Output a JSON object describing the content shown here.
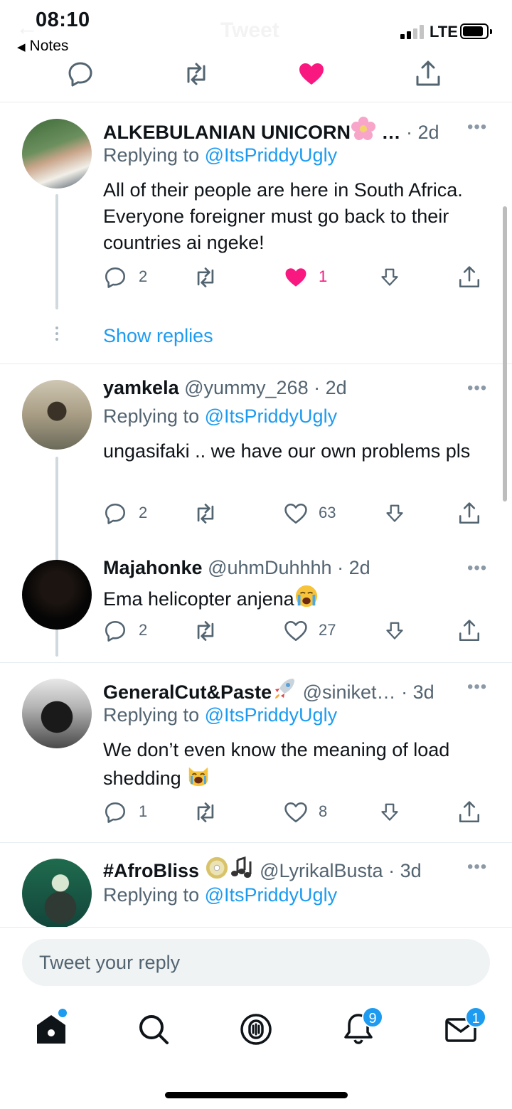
{
  "status_bar": {
    "time": "08:10",
    "back_label": "Notes",
    "network": "LTE",
    "header_title_ghost": "Tweet"
  },
  "top_actions": {
    "icons": [
      "reply-icon",
      "retweet-icon",
      "like-icon-filled",
      "share-icon"
    ],
    "liked": true
  },
  "colors": {
    "link_blue": "#1d9bf0",
    "like_pink": "#f91880",
    "secondary_text": "#536471"
  },
  "tweets": [
    {
      "name": "ALKEBULANIAN UNICORN",
      "handle": "…",
      "time": "· 2d",
      "replying_label": "Replying to",
      "replying_to": "@ItsPriddyUgly",
      "text": "All of their people are here in South Africa. Everyone foreigner must go back to their countries ai ngeke!",
      "replies": "2",
      "retweets": "",
      "likes": "1",
      "liked": true,
      "show_replies": "Show replies"
    },
    {
      "name": "yamkela",
      "handle": "@yummy_268",
      "time": "· 2d",
      "replying_label": "Replying to",
      "replying_to": "@ItsPriddyUgly",
      "text": "ungasifaki .. we have our own problems pls",
      "replies": "2",
      "retweets": "",
      "likes": "63",
      "liked": false
    },
    {
      "name": "Majahonke",
      "handle": "@uhmDuhhhh",
      "time": "· 2d",
      "text": "Ema helicopter anjena",
      "replies": "2",
      "retweets": "",
      "likes": "27",
      "liked": false
    },
    {
      "name": "GeneralCut&Paste",
      "handle": "@siniket…",
      "time": "· 3d",
      "replying_label": "Replying to",
      "replying_to": "@ItsPriddyUgly",
      "text": "We don’t even know the meaning of load shedding",
      "replies": "1",
      "retweets": "",
      "likes": "8",
      "liked": false
    },
    {
      "name": "#AfroBliss",
      "handle": "@LyrikalBusta",
      "time": "· 3d",
      "replying_label": "Replying to",
      "replying_to": "@ItsPriddyUgly"
    }
  ],
  "composer": {
    "placeholder": "Tweet your reply"
  },
  "tab_bar": {
    "tabs": [
      "home-icon",
      "search-icon",
      "spaces-icon",
      "notifications-icon",
      "messages-icon"
    ],
    "notifications_badge": "9",
    "messages_badge": "1"
  }
}
